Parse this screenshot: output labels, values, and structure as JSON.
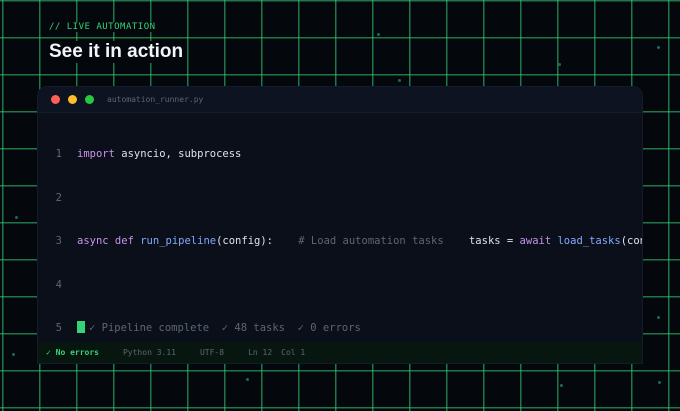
{
  "eyebrow": "// LIVE AUTOMATION",
  "heading": "See it in action",
  "editor": {
    "filename": "automation_runner.py",
    "lines": [
      {
        "number": "1",
        "segments": [
          {
            "t": "kw",
            "text": "import"
          },
          {
            "t": "plain",
            "text": " asyncio, subprocess"
          }
        ]
      },
      {
        "number": "2",
        "segments": []
      },
      {
        "number": "3",
        "segments": [
          {
            "t": "kw",
            "text": "async def"
          },
          {
            "t": "plain",
            "text": " "
          },
          {
            "t": "fn",
            "text": "run_pipeline"
          },
          {
            "t": "plain",
            "text": "(config):    "
          },
          {
            "t": "cm",
            "text": "# Load automation tasks"
          },
          {
            "t": "plain",
            "text": "    tasks = "
          },
          {
            "t": "kw",
            "text": "await"
          },
          {
            "t": "plain",
            "text": " "
          },
          {
            "t": "fn",
            "text": "load_tasks"
          },
          {
            "t": "plain",
            "text": "(config)"
          }
        ]
      },
      {
        "number": "4",
        "segments": []
      },
      {
        "number": "5",
        "segments": []
      }
    ],
    "output": {
      "complete": "✓ Pipeline complete",
      "tasks": "✓ 48 tasks",
      "errors": "✓ 0 errors"
    }
  },
  "status": {
    "errors": "✓ No errors",
    "language": "Python 3.11",
    "encoding": "UTF-8",
    "line": "Ln 12",
    "col": "Col 1"
  },
  "colors": {
    "accent": "#34d378",
    "background": "#04070b",
    "editor_bg": "#0a0f19",
    "keyword": "#c792ea",
    "function": "#82aaff",
    "comment": "#5c6675"
  }
}
